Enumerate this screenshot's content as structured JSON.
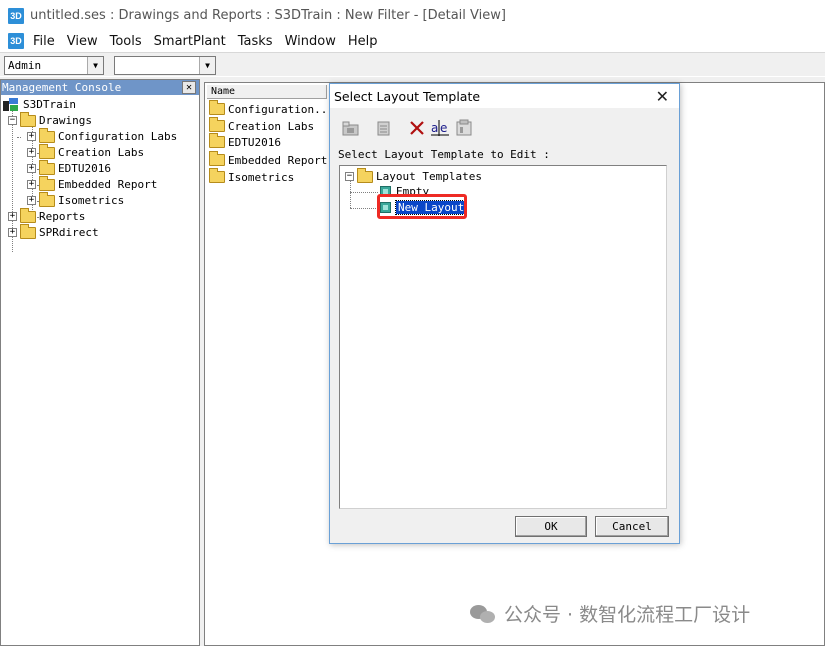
{
  "window": {
    "app_icon": "3D",
    "title": "untitled.ses : Drawings and Reports : S3DTrain : New Filter - [Detail View]"
  },
  "menubar": {
    "icon": "3D",
    "items": [
      "File",
      "View",
      "Tools",
      "SmartPlant",
      "Tasks",
      "Window",
      "Help"
    ]
  },
  "toolbar": {
    "user_combo": "Admin",
    "filter_combo": ""
  },
  "management_console": {
    "header": "Management Console",
    "close_glyph": "✕",
    "tree": {
      "root": "S3DTrain",
      "drawings": "Drawings",
      "drawings_children": [
        "Configuration Labs",
        "Creation Labs",
        "EDTU2016",
        "Embedded Report",
        "Isometrics"
      ],
      "reports": "Reports",
      "sprdirect": "SPRdirect"
    }
  },
  "detail_view": {
    "column_name": "Name",
    "items": [
      "Configuration...",
      "Creation Labs",
      "EDTU2016",
      "Embedded Report",
      "Isometrics"
    ]
  },
  "dialog": {
    "title": "Select Layout Template",
    "close_glyph": "✕",
    "prompt": "Select Layout Template to Edit :",
    "tree": {
      "root": "Layout Templates",
      "children": [
        "Empty",
        "New Layout"
      ],
      "selected": "New Layout"
    },
    "ok_label": "OK",
    "cancel_label": "Cancel"
  },
  "watermark": {
    "text": "公众号 · 数智化流程工厂设计"
  },
  "colors": {
    "selection": "#0a46c8",
    "highlight_box": "#ee2a24",
    "console_header": "#6f95c8"
  }
}
